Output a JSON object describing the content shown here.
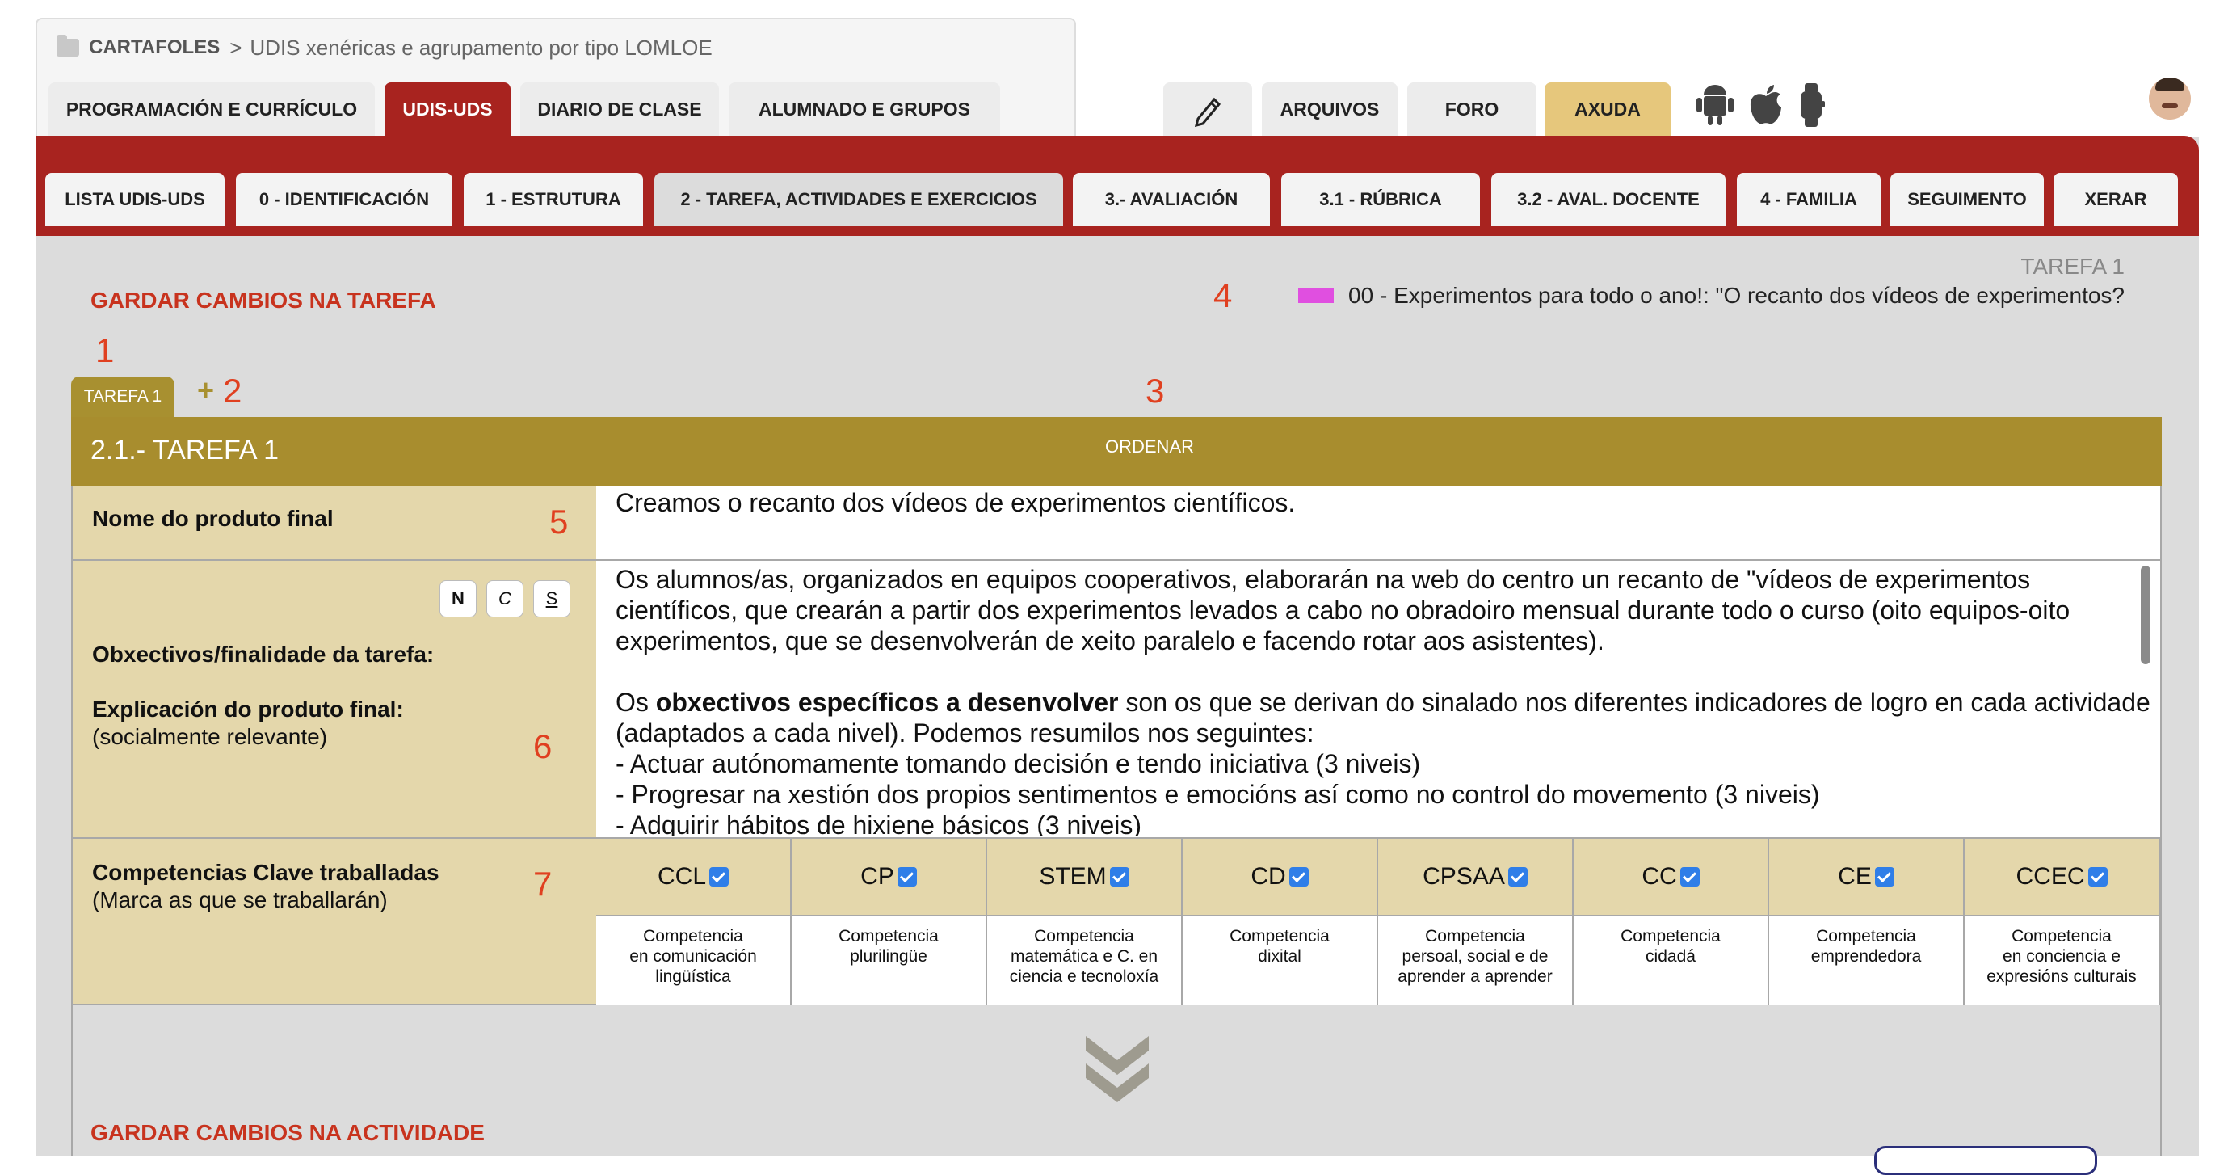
{
  "breadcrumb": {
    "root": "CARTAFOLES",
    "separator": ">",
    "current": "UDIS xenéricas e agrupamento por tipo LOMLOE"
  },
  "main_tabs": [
    {
      "label": "PROGRAMACIÓN E CURRÍCULO"
    },
    {
      "label": "UDIS-UDS",
      "active": true
    },
    {
      "label": "DIARIO DE CLASE"
    },
    {
      "label": "ALUMNADO E GRUPOS"
    }
  ],
  "right_tabs": [
    {
      "label": "ARQUIVOS"
    },
    {
      "label": "FORO"
    },
    {
      "label": "AXUDA"
    }
  ],
  "icons": {
    "pencil": "pencil-icon",
    "android": "android-icon",
    "apple": "apple-icon",
    "watch": "watch-icon",
    "avatar": "user-avatar"
  },
  "sub_tabs": [
    {
      "label": "LISTA UDIS-UDS"
    },
    {
      "label": "0 - IDENTIFICACIÓN"
    },
    {
      "label": "1 - ESTRUTURA"
    },
    {
      "label": "2 - TAREFA, ACTIVIDADES E EXERCICIOS",
      "active": true
    },
    {
      "label": "3.- AVALIACIÓN"
    },
    {
      "label": "3.1 - RÚBRICA"
    },
    {
      "label": "3.2 - AVAL. DOCENTE"
    },
    {
      "label": "4 - FAMILIA"
    },
    {
      "label": "SEGUIMENTO"
    },
    {
      "label": "XERAR"
    }
  ],
  "content": {
    "save_task": "GARDAR CAMBIOS NA TAREFA",
    "task_label_right": "TAREFA 1",
    "activity_title": "00 - Experimentos para todo o ano!: \"O recanto dos vídeos de experimentos?",
    "task_chip": "TAREFA 1",
    "add": "+",
    "section_title": "2.1.- TAREFA 1",
    "ordenar": "ORDENAR",
    "markers": {
      "m1": "1",
      "m2": "2",
      "m3": "3",
      "m4": "4",
      "m5": "5",
      "m6": "6",
      "m7": "7"
    },
    "product_label": "Nome do produto final",
    "product_value": "Creamos o recanto dos vídeos de experimentos científicos.",
    "format_buttons": {
      "n": "N",
      "c": "C",
      "s": "S"
    },
    "objectives_label": "Obxectivos/finalidade da tarefa:",
    "explanation_label": "Explicación do produto final:",
    "explanation_sub": "(socialmente relevante)",
    "objectives_text": {
      "p1": "Os alumnos/as, organizados en equipos cooperativos, elaborarán na web do centro un recanto de \"vídeos de experimentos científicos, que crearán a partir  dos experimentos levados a cabo no obradoiro mensual durante todo o curso (oito equipos-oito experimentos, que se desenvolverán de xeito paralelo e facendo rotar aos asistentes).",
      "p2_pre": "Os ",
      "p2_bold": "obxectivos específicos a desenvolver",
      "p2_post": " son os que se derivan do sinalado nos  diferentes indicadores de logro en cada actividade (adaptados a cada nivel). Podemos resumilos nos seguintes:",
      "b1": "- Actuar autónomamente tomando decisión e tendo iniciativa (3 niveis)",
      "b2": "- Progresar na xestión dos propios sentimentos e emocións así como no control do movemento (3 niveis)",
      "b3": "- Adquirir hábitos de hixiene básicos (3 niveis)"
    },
    "competencias_label": "Competencias Clave traballadas",
    "competencias_sub": "(Marca as que se traballarán)",
    "competencias": [
      {
        "code": "CCL",
        "desc1": "Competencia",
        "desc2": "en comunicación",
        "desc3": "lingüística"
      },
      {
        "code": "CP",
        "desc1": "Competencia",
        "desc2": "plurilingüe",
        "desc3": ""
      },
      {
        "code": "STEM",
        "desc1": "Competencia",
        "desc2": "matemática e C. en",
        "desc3": "ciencia e tecnoloxía"
      },
      {
        "code": "CD",
        "desc1": "Competencia",
        "desc2": "dixital",
        "desc3": ""
      },
      {
        "code": "CPSAA",
        "desc1": "Competencia",
        "desc2": "persoal, social e de",
        "desc3": "aprender a aprender"
      },
      {
        "code": "CC",
        "desc1": "Competencia",
        "desc2": "cidadá",
        "desc3": ""
      },
      {
        "code": "CE",
        "desc1": "Competencia",
        "desc2": "emprendedora",
        "desc3": ""
      },
      {
        "code": "CCEC",
        "desc1": "Competencia",
        "desc2": "en conciencia e",
        "desc3": "expresións culturais"
      }
    ],
    "save_activity": "GARDAR CAMBIOS NA ACTIVIDADE"
  }
}
